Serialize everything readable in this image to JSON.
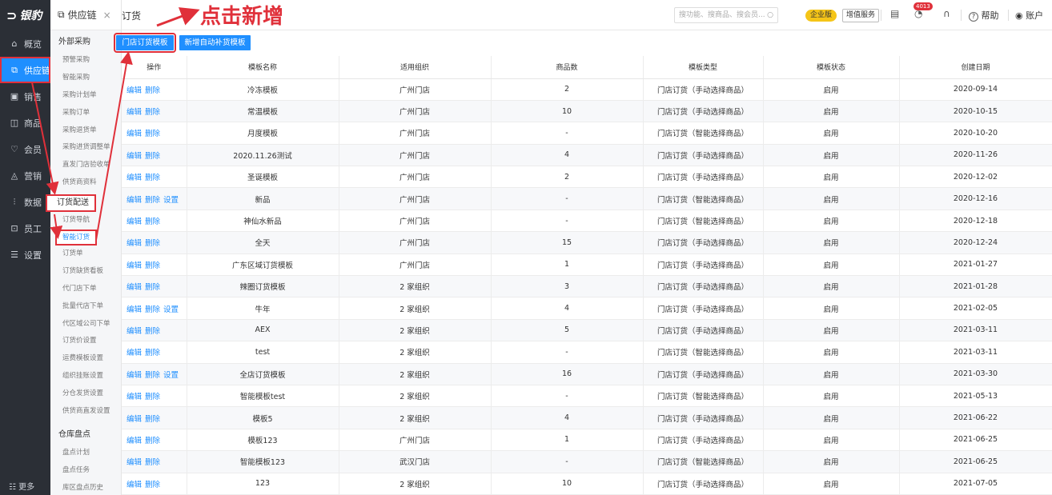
{
  "logo": {
    "mark": "⊃",
    "text": "银豹"
  },
  "nav": {
    "items": [
      {
        "icon": "⌂",
        "label": "概览"
      },
      {
        "icon": "⧉",
        "label": "供应链"
      },
      {
        "icon": "▣",
        "label": "销售"
      },
      {
        "icon": "◫",
        "label": "商品"
      },
      {
        "icon": "♡",
        "label": "会员"
      },
      {
        "icon": "◬",
        "label": "营销"
      },
      {
        "icon": "⫶",
        "label": "数据"
      },
      {
        "icon": "⊡",
        "label": "员工"
      },
      {
        "icon": "☰",
        "label": "设置"
      }
    ],
    "more_label": "更多",
    "more_icon": "☷"
  },
  "submenu": {
    "title_icon": "⧉",
    "title": "供应链",
    "close": "×",
    "group1": "外部采购",
    "group1_items": [
      "预警采购",
      "智能采购",
      "采购计划单",
      "采购订单",
      "采购退货单",
      "采购进货调整单",
      "直发门店验收单",
      "供货商资料"
    ],
    "group2": "订货配送",
    "group2_items": [
      "订货导航",
      "智能订货",
      "订货单",
      "订货缺货看板",
      "代门店下单",
      "批量代店下单",
      "代区域公司下单",
      "订货价设置",
      "运费模板设置",
      "组织挂账设置",
      "分仓发货设置",
      "供货商直发设置"
    ],
    "group3": "仓库盘点",
    "group3_items": [
      "盘点计划",
      "盘点任务",
      "库区盘点历史"
    ]
  },
  "topbar": {
    "breadcrumb": "订货",
    "search_placeholder": "搜功能、搜商品、搜会员...",
    "search_icon": "○",
    "enterprise_badge": "企业版",
    "vas_badge": "增值服务",
    "msg_count": "4013",
    "help": "帮助",
    "account": "账户",
    "help_icon": "?",
    "account_icon": "◉",
    "clipboard_icon": "▤",
    "bell_icon": "◔",
    "headset_icon": "∩"
  },
  "annotation": {
    "text": "点击新增"
  },
  "toolbar": {
    "store_template": "门店订货模板",
    "auto_template": "新增自动补货模板"
  },
  "table": {
    "headers": [
      "操作",
      "模板名称",
      "适用组织",
      "商品数",
      "模板类型",
      "模板状态",
      "创建日期"
    ],
    "op_edit": "编辑",
    "op_delete": "删除",
    "op_setting": "设置",
    "rows": [
      {
        "setting": false,
        "name": "冷冻模板",
        "org": "广州门店",
        "count": "2",
        "type": "门店订货（手动选择商品）",
        "status": "启用",
        "date": "2020-09-14"
      },
      {
        "setting": false,
        "name": "常温模板",
        "org": "广州门店",
        "count": "10",
        "type": "门店订货（手动选择商品）",
        "status": "启用",
        "date": "2020-10-15"
      },
      {
        "setting": false,
        "name": "月度模板",
        "org": "广州门店",
        "count": "-",
        "type": "门店订货（智能选择商品）",
        "status": "启用",
        "date": "2020-10-20"
      },
      {
        "setting": false,
        "name": "2020.11.26测试",
        "org": "广州门店",
        "count": "4",
        "type": "门店订货（手动选择商品）",
        "status": "启用",
        "date": "2020-11-26"
      },
      {
        "setting": false,
        "name": "圣诞模板",
        "org": "广州门店",
        "count": "2",
        "type": "门店订货（手动选择商品）",
        "status": "启用",
        "date": "2020-12-02"
      },
      {
        "setting": true,
        "name": "新品",
        "org": "广州门店",
        "count": "-",
        "type": "门店订货（智能选择商品）",
        "status": "启用",
        "date": "2020-12-16"
      },
      {
        "setting": false,
        "name": "神仙水新品",
        "org": "广州门店",
        "count": "-",
        "type": "门店订货（智能选择商品）",
        "status": "启用",
        "date": "2020-12-18"
      },
      {
        "setting": false,
        "name": "全天",
        "org": "广州门店",
        "count": "15",
        "type": "门店订货（手动选择商品）",
        "status": "启用",
        "date": "2020-12-24"
      },
      {
        "setting": false,
        "name": "广东区域订货模板",
        "org": "广州门店",
        "count": "1",
        "type": "门店订货（手动选择商品）",
        "status": "启用",
        "date": "2021-01-27"
      },
      {
        "setting": false,
        "name": "辣圈订货模板",
        "org": "2 家组织",
        "count": "3",
        "type": "门店订货（手动选择商品）",
        "status": "启用",
        "date": "2021-01-28"
      },
      {
        "setting": true,
        "name": "牛年",
        "org": "2 家组织",
        "count": "4",
        "type": "门店订货（手动选择商品）",
        "status": "启用",
        "date": "2021-02-05"
      },
      {
        "setting": false,
        "name": "AEX",
        "org": "2 家组织",
        "count": "5",
        "type": "门店订货（手动选择商品）",
        "status": "启用",
        "date": "2021-03-11"
      },
      {
        "setting": false,
        "name": "test",
        "org": "2 家组织",
        "count": "-",
        "type": "门店订货（智能选择商品）",
        "status": "启用",
        "date": "2021-03-11"
      },
      {
        "setting": true,
        "name": "全店订货模板",
        "org": "2 家组织",
        "count": "16",
        "type": "门店订货（手动选择商品）",
        "status": "启用",
        "date": "2021-03-30"
      },
      {
        "setting": false,
        "name": "智能模板test",
        "org": "2 家组织",
        "count": "-",
        "type": "门店订货（智能选择商品）",
        "status": "启用",
        "date": "2021-05-13"
      },
      {
        "setting": false,
        "name": "模板5",
        "org": "2 家组织",
        "count": "4",
        "type": "门店订货（手动选择商品）",
        "status": "启用",
        "date": "2021-06-22"
      },
      {
        "setting": false,
        "name": "模板123",
        "org": "广州门店",
        "count": "1",
        "type": "门店订货（手动选择商品）",
        "status": "启用",
        "date": "2021-06-25"
      },
      {
        "setting": false,
        "name": "智能模板123",
        "org": "武汉门店",
        "count": "-",
        "type": "门店订货（智能选择商品）",
        "status": "启用",
        "date": "2021-06-25"
      },
      {
        "setting": false,
        "name": "123",
        "org": "2 家组织",
        "count": "10",
        "type": "门店订货（手动选择商品）",
        "status": "启用",
        "date": "2021-07-05"
      }
    ]
  },
  "colors": {
    "accent": "#1f8fff",
    "annotation": "#e0303a",
    "nav_bg": "#2b2f36"
  }
}
